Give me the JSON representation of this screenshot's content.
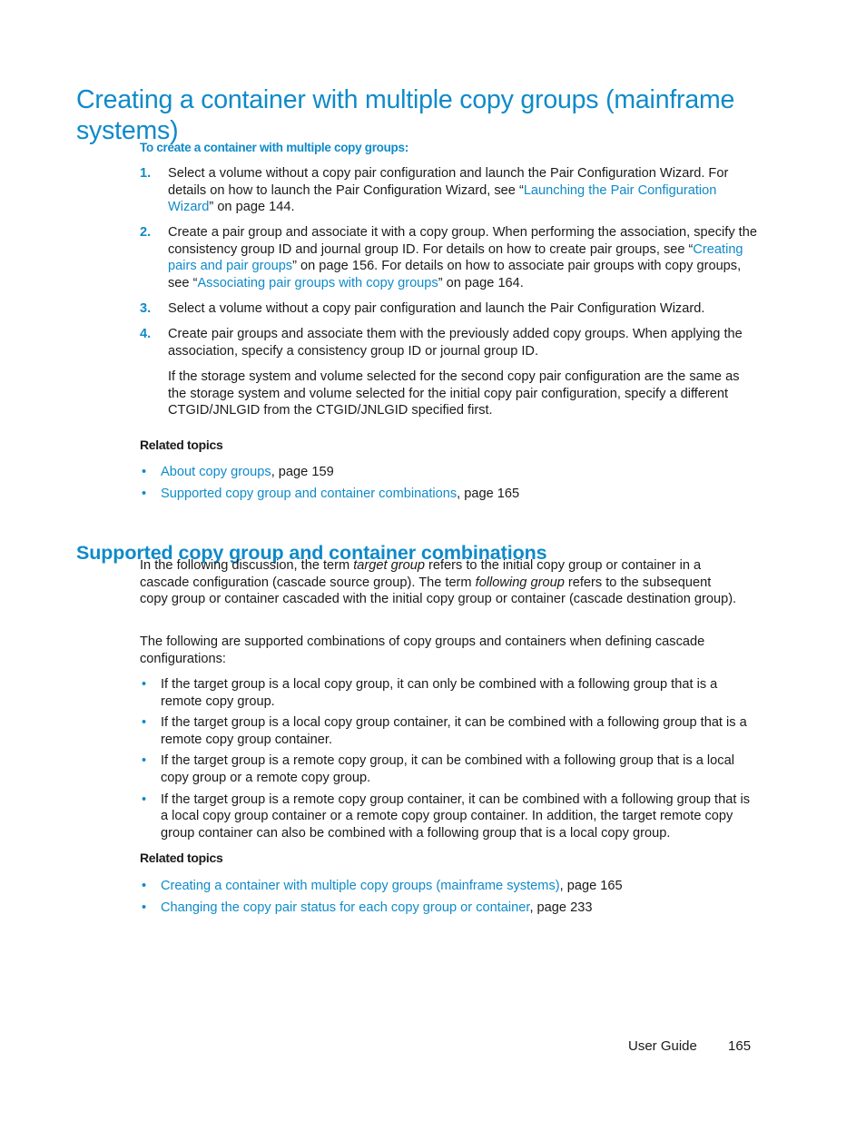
{
  "section1": {
    "title": "Creating a container with multiple copy groups (mainframe systems)",
    "procedure_title": "To create a container with multiple copy groups:",
    "steps": [
      {
        "num": "1.",
        "pre": "Select a volume without a copy pair configuration and launch the Pair Configuration Wizard. For details on how to launch the Pair Configuration Wizard, see “",
        "link": "Launching the Pair Configuration Wizard",
        "post": "” on page 144."
      },
      {
        "num": "2.",
        "pre": "Create a pair group and associate it with a copy group. When performing the association, specify the consistency group ID and journal group ID. For details on how to create pair groups, see “",
        "link": "Creating pairs and pair groups",
        "mid": "” on page 156. For details on how to associate pair groups with copy groups, see “",
        "link2": "Associating pair groups with copy groups",
        "post": "” on page 164."
      },
      {
        "num": "3.",
        "text": "Select a volume without a copy pair configuration and launch the Pair Configuration Wizard."
      },
      {
        "num": "4.",
        "text": "Create pair groups and associate them with the previously added copy groups. When applying the association, specify a consistency group ID or journal group ID.",
        "note": "If the storage system and volume selected for the second copy pair configuration are the same as the storage system and volume selected for the initial copy pair configuration, specify a different CTGID/JNLGID  from the CTGID/JNLGID specified first."
      }
    ],
    "related_title": "Related topics",
    "related": [
      {
        "link": "About copy groups",
        "page": ", page 159"
      },
      {
        "link": "Supported copy group and container combinations",
        "page": ", page 165"
      }
    ]
  },
  "section2": {
    "title": "Supported copy group and container combinations",
    "intro": {
      "p1": "In the following discussion, the term ",
      "em1": "target group",
      "p2": " refers to the initial copy group or container in a cascade configuration (cascade source group). The term ",
      "em2": "following group",
      "p3": " refers to the subsequent copy group or container cascaded with the initial copy group or container (cascade destination group)."
    },
    "lead": "The following are supported combinations of copy groups and containers when defining cascade configurations:",
    "bullets": [
      "If the target group is a local copy group, it can only be combined with a following group that is a remote copy group.",
      "If the target group is a local copy group container, it can be combined with a following group that is a remote copy group container.",
      "If the target group is a remote copy group, it can be combined with a following group that is a local copy group or a remote copy group.",
      "If the target group is a remote copy group container, it can be combined with a following group that is a local copy group container or a remote copy group container. In addition, the target remote copy group container can also be combined with a following group that is a local copy group."
    ],
    "related_title": "Related topics",
    "related": [
      {
        "link": "Creating a container with multiple copy groups (mainframe systems)",
        "page": ", page 165"
      },
      {
        "link": "Changing the copy pair status for each copy group or container",
        "page": ", page 233"
      }
    ]
  },
  "footer": {
    "guide": "User Guide",
    "page_number": "165"
  },
  "bullet_glyph": "•",
  "colors": {
    "accent": "#0f8ac9",
    "text": "#1a1a1a"
  }
}
